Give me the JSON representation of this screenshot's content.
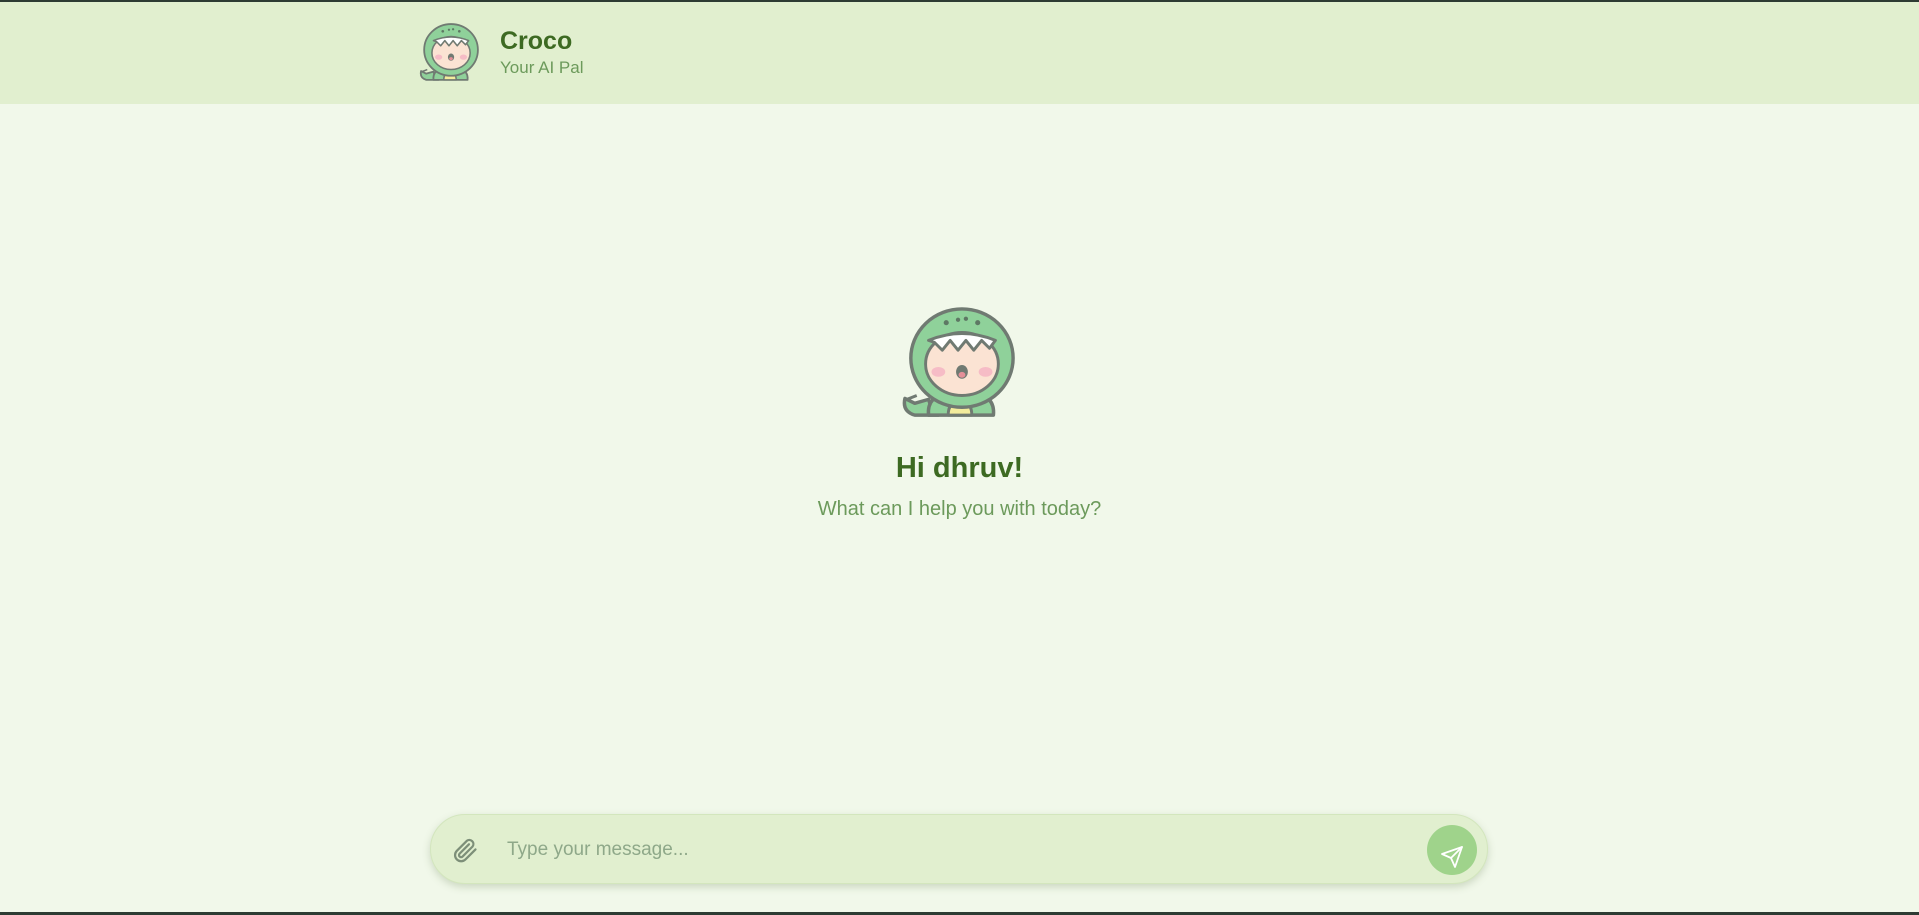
{
  "header": {
    "title": "Croco",
    "subtitle": "Your AI Pal",
    "avatar_icon": "croco-mascot-icon"
  },
  "welcome": {
    "greeting": "Hi dhruv!",
    "prompt": "What can I help you with today?",
    "avatar_icon": "croco-mascot-icon"
  },
  "composer": {
    "placeholder": "Type your message...",
    "value": "",
    "attach_icon": "paperclip-icon",
    "send_icon": "send-icon"
  },
  "colors": {
    "background": "#f1f8ea",
    "header_background": "#e1efcf",
    "title": "#3d6a22",
    "subtitle": "#6c9a5b",
    "send_button": "#9fd38b"
  }
}
